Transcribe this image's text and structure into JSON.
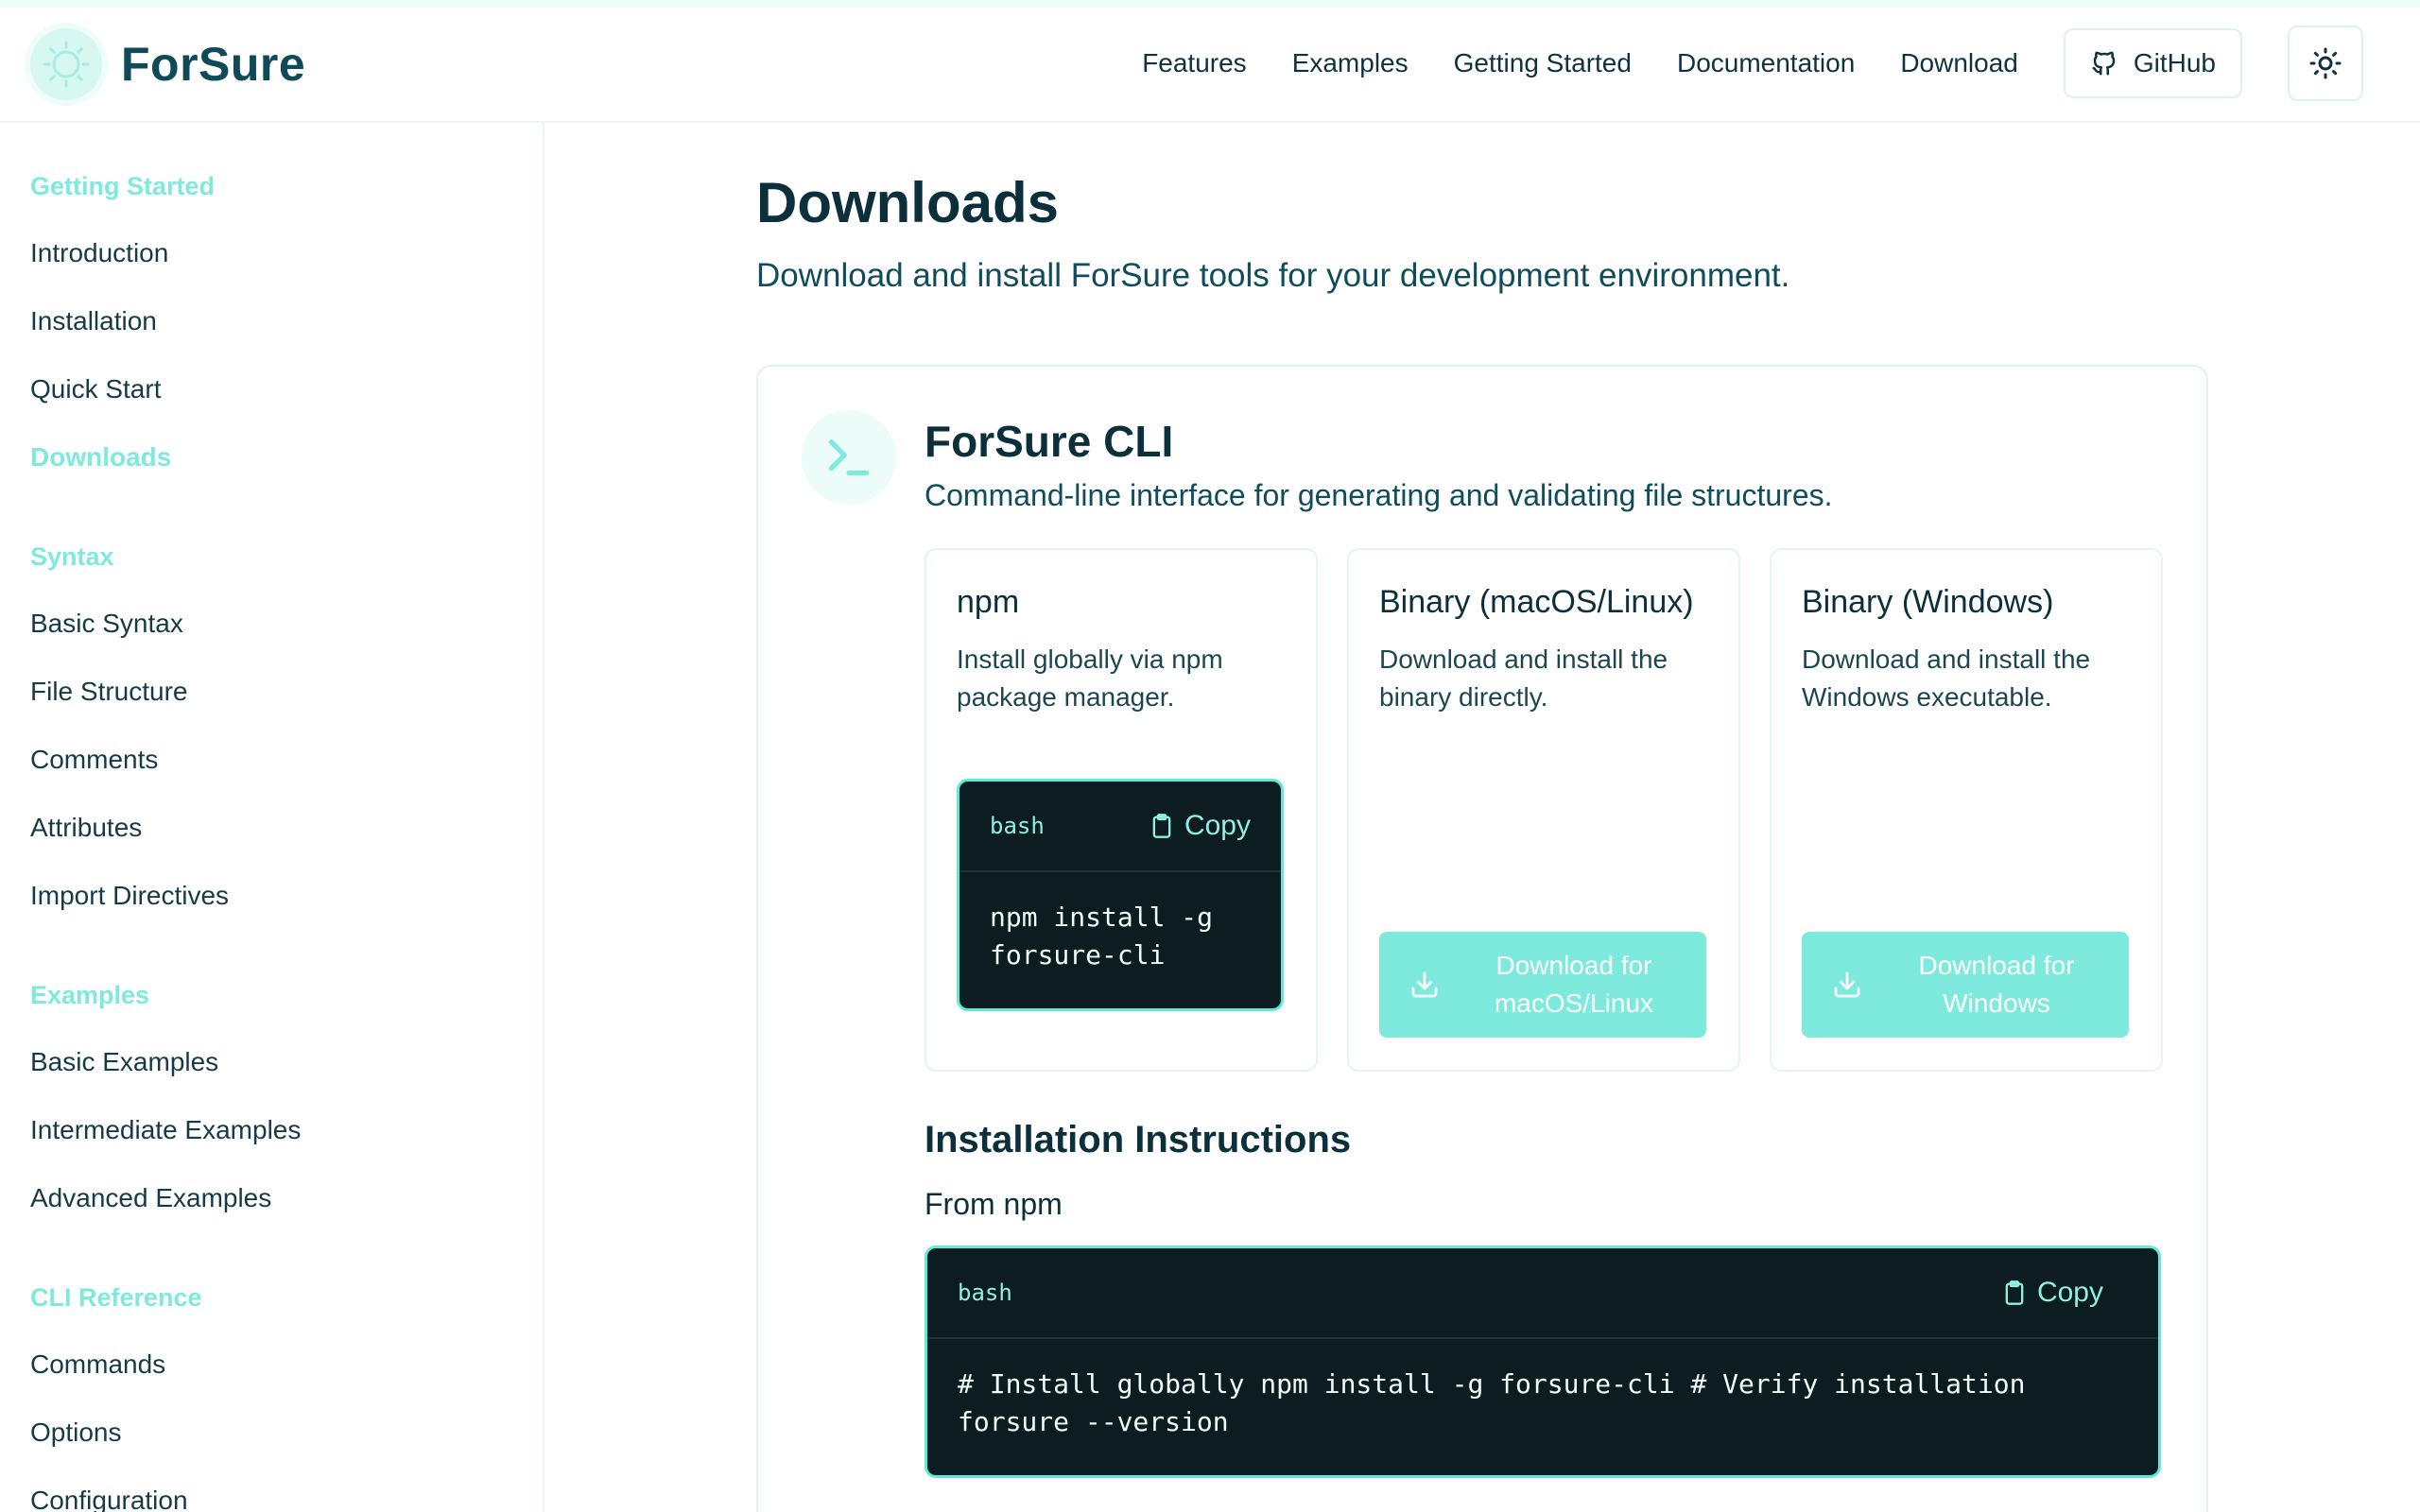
{
  "header": {
    "brand": "ForSure",
    "nav": [
      "Features",
      "Examples",
      "Getting Started",
      "Documentation",
      "Download"
    ],
    "github_label": "GitHub"
  },
  "sidebar": {
    "sections": [
      {
        "title": "Getting Started",
        "items": [
          "Introduction",
          "Installation",
          "Quick Start",
          "Downloads"
        ]
      },
      {
        "title": "Syntax",
        "items": [
          "Basic Syntax",
          "File Structure",
          "Comments",
          "Attributes",
          "Import Directives"
        ]
      },
      {
        "title": "Examples",
        "items": [
          "Basic Examples",
          "Intermediate Examples",
          "Advanced Examples"
        ]
      },
      {
        "title": "CLI Reference",
        "items": [
          "Commands",
          "Options",
          "Configuration"
        ]
      }
    ],
    "active_item": "Downloads"
  },
  "main": {
    "title": "Downloads",
    "subtitle": "Download and install ForSure tools for your development environment.",
    "cli": {
      "title": "ForSure CLI",
      "description": "Command-line interface for generating and validating file structures.",
      "options": [
        {
          "title": "npm",
          "description": "Install globally via npm package manager.",
          "code_lang": "bash",
          "copy_label": "Copy",
          "code_lines": [
            "npm install -g",
            "forsure-cli"
          ]
        },
        {
          "title": "Binary (macOS/Linux)",
          "description": "Download and install the binary directly.",
          "button_lines": [
            "Download for",
            "macOS/Linux"
          ]
        },
        {
          "title": "Binary (Windows)",
          "description": "Download and install the Windows executable.",
          "button_lines": [
            "Download for",
            "Windows"
          ]
        }
      ]
    },
    "instructions": {
      "title": "Installation Instructions",
      "subtitle": "From npm",
      "code_lang": "bash",
      "copy_label": "Copy",
      "code_lines": [
        "# Install globally npm install -g forsure-cli # Verify installation",
        "forsure --version"
      ]
    }
  },
  "colors": {
    "accent": "#7ee9dc",
    "accent_border": "#5eead4",
    "code_bg": "#0c1c20",
    "heading": "#0c2f3c",
    "indicator_dot": "#6366f1"
  },
  "icons": {
    "logo": "sun-badge-icon",
    "github": "github-icon",
    "theme": "sun-icon",
    "cli": "terminal-icon",
    "copy": "clipboard-icon",
    "download": "download-icon"
  }
}
